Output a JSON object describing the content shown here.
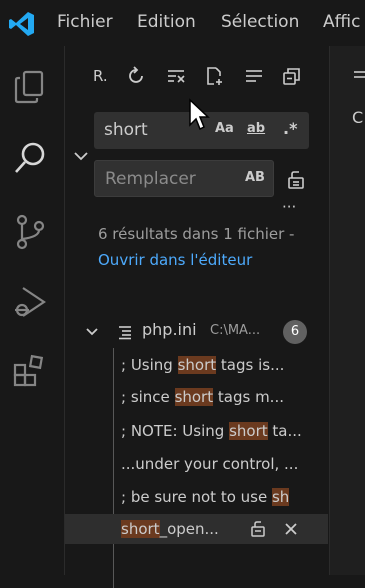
{
  "menubar": {
    "items": [
      "Fichier",
      "Edition",
      "Sélection",
      "Affic"
    ]
  },
  "activitybar": {
    "icons": [
      "explorer-icon",
      "search-icon",
      "source-control-icon",
      "run-debug-icon",
      "extensions-icon"
    ]
  },
  "toolbar": {
    "label_r": "R.",
    "actions": [
      "refresh-icon",
      "clear-results-icon",
      "new-search-editor-icon",
      "view-as-tree-icon",
      "collapse-all-icon"
    ]
  },
  "search": {
    "value": "short",
    "match_case": "Aa",
    "whole_word": "ab",
    "regex": ".*"
  },
  "replace": {
    "placeholder": "Remplacer",
    "preserve_case": "AB",
    "more": "···"
  },
  "summary": {
    "text": "6 résultats dans 1 fichier - ",
    "link": "Ouvrir dans l'éditeur"
  },
  "file": {
    "name": "php.ini",
    "path": "C:\\MA...",
    "count": "6"
  },
  "matches": [
    {
      "pre": ";     Using ",
      "hit": "short",
      "post": " tags is..."
    },
    {
      "pre": ";     since ",
      "hit": "short",
      "post": " tags m..."
    },
    {
      "pre": "; NOTE: Using ",
      "hit": "short",
      "post": " ta..."
    },
    {
      "pre": "...under your control, ...",
      "hit": "",
      "post": ""
    },
    {
      "pre": "; be sure not to use ",
      "hit": "sh",
      "post": ""
    },
    {
      "pre": "",
      "hit": "short",
      "post": "_open..."
    }
  ],
  "editor": {
    "tab_partial": "C"
  },
  "colors": {
    "background": "#181818",
    "accent_link": "#4daafc",
    "highlight": "#6b3a1f",
    "vscode_blue": "#23a9f2"
  }
}
